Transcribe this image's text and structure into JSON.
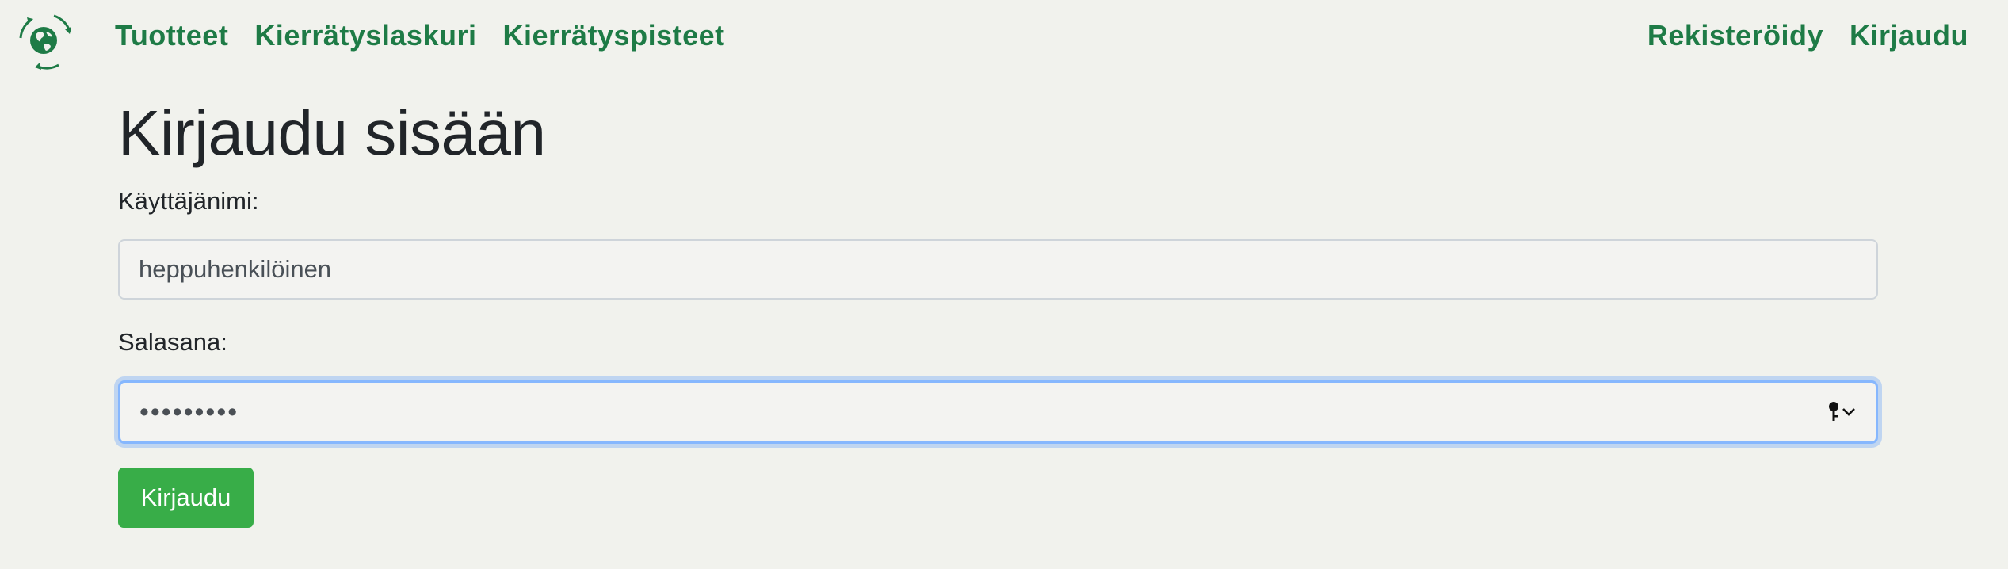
{
  "navbar": {
    "logo_icon": "recycling-globe-logo",
    "left_links": [
      "Tuotteet",
      "Kierrätyslaskuri",
      "Kierrätyspisteet"
    ],
    "right_links": [
      "Rekisteröidy",
      "Kirjaudu"
    ]
  },
  "page": {
    "title": "Kirjaudu sisään"
  },
  "form": {
    "username_label": "Käyttäjänimi:",
    "username_value": "heppuhenkilöinen",
    "password_label": "Salasana:",
    "password_value": "•••••••••",
    "password_icon": "key-dropdown-icon",
    "submit_label": "Kirjaudu"
  },
  "colors": {
    "background": "#f1f2ed",
    "nav_link": "#1e7b46",
    "button": "#38ad48",
    "focus_border": "#86b7fe"
  }
}
